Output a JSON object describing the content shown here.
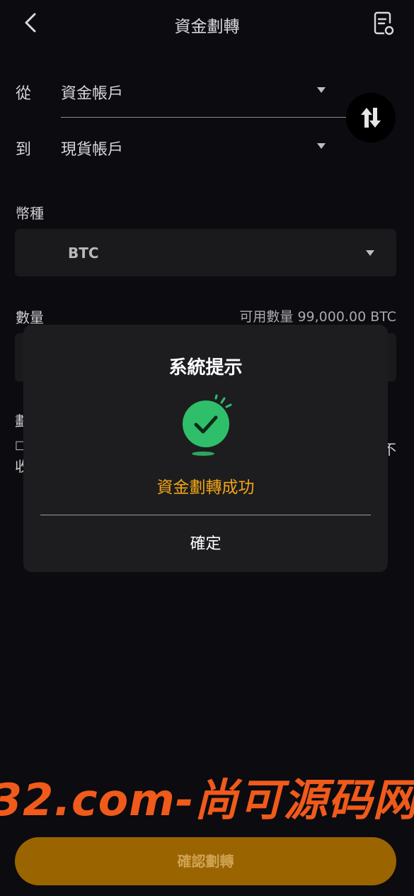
{
  "header": {
    "title": "資金劃轉",
    "back_icon": "chevron-left-icon",
    "record_icon": "document-search-icon"
  },
  "transfer": {
    "from_label": "從",
    "from_value": "資金帳戶",
    "to_label": "到",
    "to_value": "現貨帳戶",
    "swap_icon": "swap-arrows-icon"
  },
  "coin": {
    "label": "幣種",
    "value": "BTC"
  },
  "amount": {
    "label": "數量",
    "available": "可用數量 99,000.00 BTC"
  },
  "notes": {
    "line1_start": "劃",
    "line2_start": "□",
    "line2_end": "不",
    "line3_start": "收"
  },
  "watermark": "32.com-尚可源码网",
  "footer": {
    "confirm_label": "確認劃轉"
  },
  "dialog": {
    "title": "系統提示",
    "message": "資金劃轉成功",
    "ok_label": "確定",
    "icon": "success-check-icon"
  },
  "colors": {
    "background": "#0b0b10",
    "accent_orange": "#f2a514",
    "button_brown": "#9a6400",
    "success_green": "#2fbf6a",
    "watermark": "#f05a1a"
  }
}
